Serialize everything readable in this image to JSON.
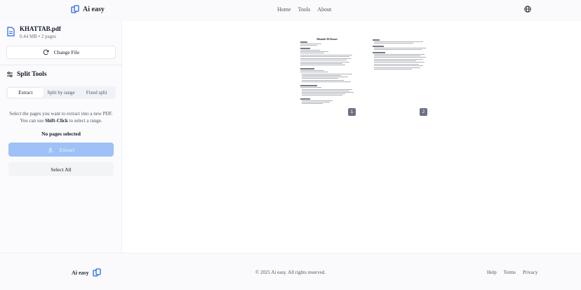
{
  "header": {
    "brand": "Ai easy",
    "nav": [
      "Home",
      "Tools",
      "About"
    ],
    "language_icon": "globe-icon"
  },
  "file": {
    "name": "KHATTAB.pdf",
    "meta": "0.44 MB • 2 pages",
    "change_label": "Change File"
  },
  "split_tools": {
    "title": "Split Tools",
    "tabs": [
      "Extract",
      "Split by range",
      "Fixed split"
    ],
    "active_tab": "Extract",
    "help_line1": "Select the pages you want to extract into a new PDF.",
    "help_line2_pre": "You can use ",
    "help_line2_bold": "Shift-Click",
    "help_line2_post": " to select a range.",
    "no_selection": "No pages selected",
    "extract_label": "Extract",
    "select_all_label": "Select All"
  },
  "pages": [
    {
      "number": "1",
      "heading": "Khattab Ali Rezaei"
    },
    {
      "number": "2"
    }
  ],
  "footer": {
    "brand": "Ai easy",
    "copyright": "© 2025 Ai easy. All rights reserved.",
    "links": [
      "Help",
      "Terms",
      "Privacy"
    ]
  },
  "colors": {
    "accent_disabled": "#9ec1f7",
    "brand_blue": "#2563eb"
  }
}
